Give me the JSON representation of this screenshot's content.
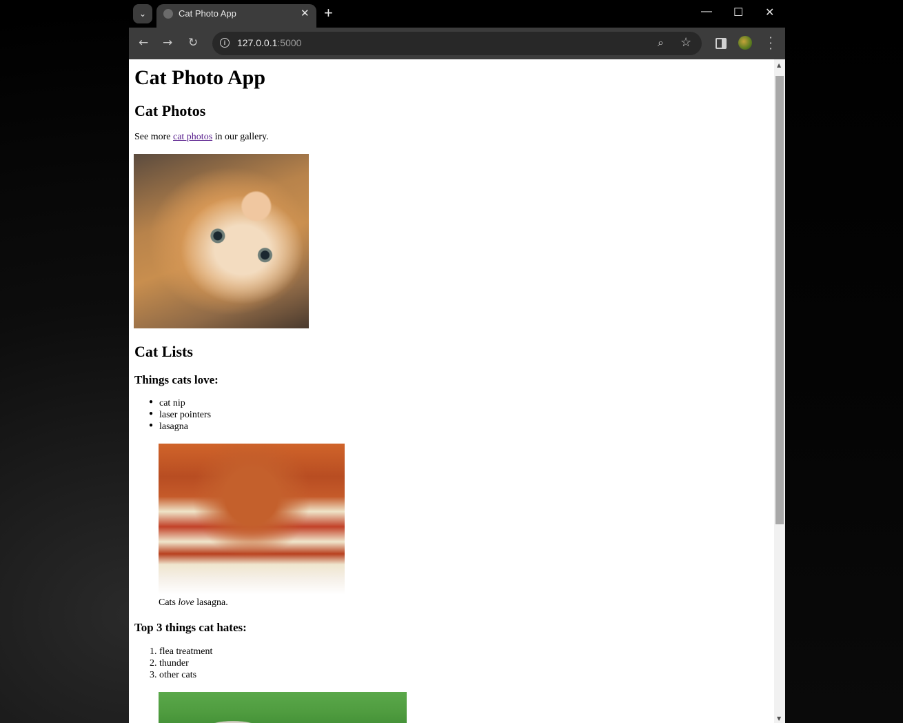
{
  "browser": {
    "tab_title": "Cat Photo App",
    "tab_close": "✕",
    "new_tab": "+",
    "url_host": "127.0.0.1",
    "url_port": ":5000",
    "controls": {
      "minimize": "—",
      "maximize": "☐",
      "close": "✕"
    },
    "icons": {
      "tab_search": "chevron-down-icon",
      "back": "back-arrow-icon",
      "forward": "forward-arrow-icon",
      "reload": "reload-icon",
      "site_info": "info-icon",
      "zoom": "zoom-icon",
      "bookmark": "star-icon",
      "side_panel": "side-panel-icon",
      "profile": "avatar",
      "menu": "kebab-menu-icon"
    }
  },
  "page": {
    "title": "Cat Photo App",
    "section_photos": {
      "heading": "Cat Photos",
      "text_before": "See more ",
      "link": "cat photos",
      "text_after": " in our gallery."
    },
    "section_lists": {
      "heading": "Cat Lists",
      "love_heading": "Things cats love:",
      "love_items": [
        "cat nip",
        "laser pointers",
        "lasagna"
      ],
      "caption_before": "Cats ",
      "caption_em": "love",
      "caption_after": " lasagna.",
      "hate_heading": "Top 3 things cat hates:",
      "hate_items": [
        "flea treatment",
        "thunder",
        "other cats"
      ]
    }
  }
}
